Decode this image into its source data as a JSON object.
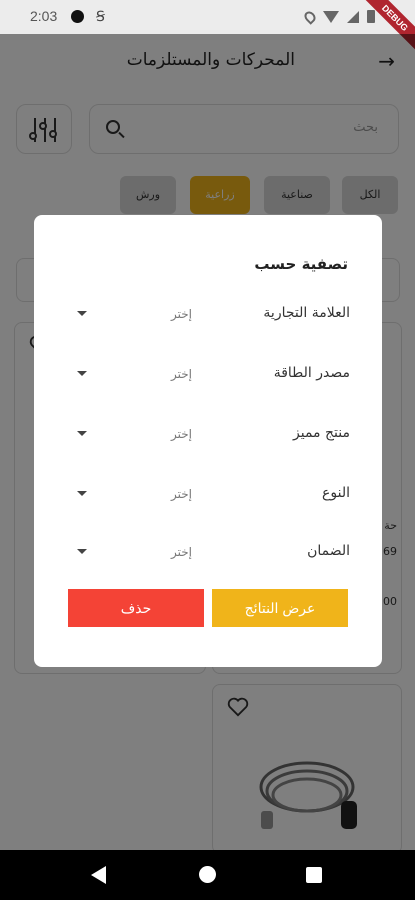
{
  "status_bar": {
    "time": "2:03",
    "extra_glyph": "Ꞩ",
    "debug_label": "DEBUG"
  },
  "app_bar": {
    "title": "المحركات والمستلزمات",
    "back_icon": "arrow-right-icon"
  },
  "search": {
    "placeholder": "بحث"
  },
  "categories": [
    {
      "label": "الكل",
      "active": false
    },
    {
      "label": "صناعية",
      "active": false
    },
    {
      "label": "زراعية",
      "active": true
    },
    {
      "label": "ورش",
      "active": false
    }
  ],
  "background_peek": {
    "price_fragment": "69",
    "price_fragment_2": "00",
    "currency_fragment": "حة"
  },
  "dialog": {
    "title": "تصفية حسب",
    "rows": [
      {
        "label": "العلامة التجارية",
        "value": "إختر"
      },
      {
        "label": "مصدر الطاقة",
        "value": "إختر"
      },
      {
        "label": "منتج مميز",
        "value": "إختر"
      },
      {
        "label": "النوع",
        "value": "إختر"
      },
      {
        "label": "الضمان",
        "value": "إختر"
      }
    ],
    "show_results_label": "عرض النتائج",
    "clear_label": "حذف"
  },
  "colors": {
    "accent": "#f0b41a",
    "danger": "#f44336",
    "overlay": "rgba(0,0,0,0.5)"
  }
}
